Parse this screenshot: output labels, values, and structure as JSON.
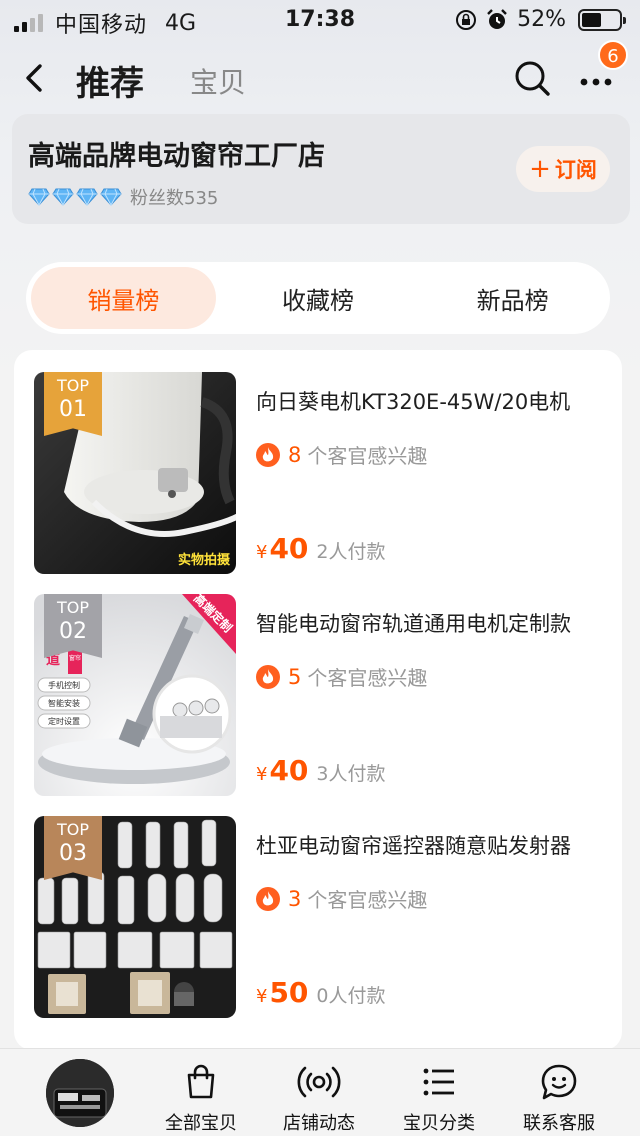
{
  "status_bar": {
    "carrier": "中国移动",
    "network": "4G",
    "time": "17:38",
    "battery": "52%"
  },
  "nav": {
    "title": "推荐",
    "tab2": "宝贝",
    "badge_count": "6"
  },
  "shop": {
    "name": "高端品牌电动窗帘工厂店",
    "fans": "粉丝数535",
    "subscribe_label": "订阅",
    "subscribe_icon": "plus-icon"
  },
  "tabs": [
    {
      "label": "销量榜",
      "active": true
    },
    {
      "label": "收藏榜",
      "active": false
    },
    {
      "label": "新品榜",
      "active": false
    }
  ],
  "products": [
    {
      "rank_label": "TOP",
      "rank": "01",
      "title": "向日葵电机KT320E-45W/20电机",
      "interest_count": "8",
      "interest_label": "个客官感兴趣",
      "currency": "¥",
      "price": "40",
      "paid": "2人付款",
      "watermark": "实物拍摄"
    },
    {
      "rank_label": "TOP",
      "rank": "02",
      "title": "智能电动窗帘轨道通用电机定制款",
      "interest_count": "5",
      "interest_label": "个客官感兴趣",
      "currency": "¥",
      "price": "40",
      "paid": "3人付款",
      "ribbon": "高端定制",
      "side_tags": [
        "手机控制",
        "智能安装",
        "定时设置"
      ],
      "side_tag_top": "道",
      "side_tag_top2": "窗帘"
    },
    {
      "rank_label": "TOP",
      "rank": "03",
      "title": "杜亚电动窗帘遥控器随意贴发射器",
      "interest_count": "3",
      "interest_label": "个客官感兴趣",
      "currency": "¥",
      "price": "50",
      "paid": "0人付款"
    }
  ],
  "tabbar": [
    {
      "label": "全部宝贝",
      "icon": "bag-icon"
    },
    {
      "label": "店铺动态",
      "icon": "broadcast-icon"
    },
    {
      "label": "宝贝分类",
      "icon": "list-icon"
    },
    {
      "label": "联系客服",
      "icon": "chat-icon"
    }
  ],
  "colors": {
    "accent": "#ff5500",
    "gold": "#e6a33a",
    "silver": "#a3a3a8",
    "bronze": "#b8865a"
  }
}
